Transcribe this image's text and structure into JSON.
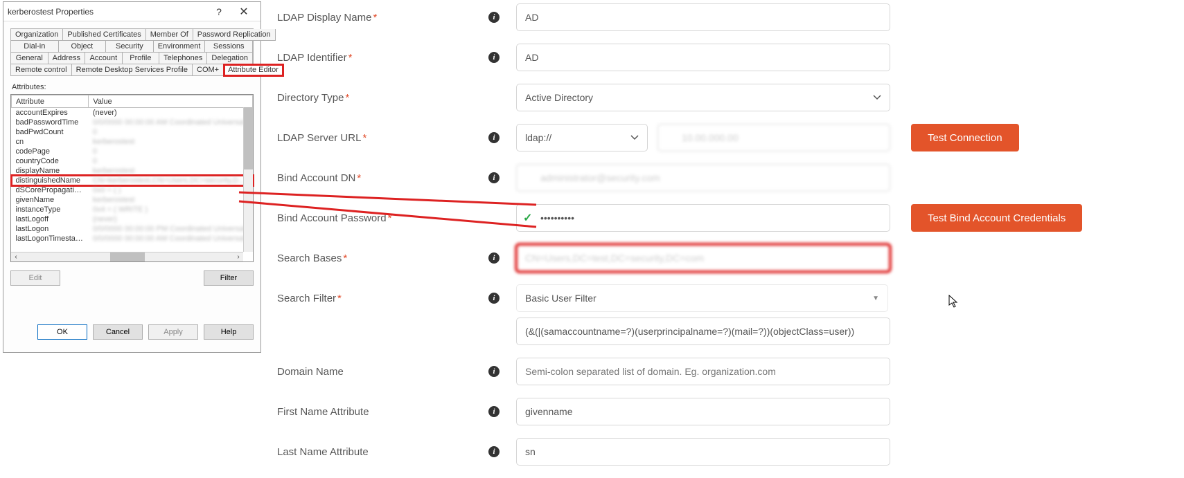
{
  "dialog": {
    "title": "kerberostest Properties",
    "help_label": "?",
    "close_label": "✕",
    "tab_rows": [
      [
        "Organization",
        "Published Certificates",
        "Member Of",
        "Password Replication"
      ],
      [
        "Dial-in",
        "Object",
        "Security",
        "Environment",
        "Sessions"
      ],
      [
        "General",
        "Address",
        "Account",
        "Profile",
        "Telephones",
        "Delegation"
      ],
      [
        "Remote control",
        "Remote Desktop Services Profile",
        "COM+",
        "Attribute Editor"
      ]
    ],
    "active_tab": "Attribute Editor",
    "attributes_label": "Attributes:",
    "columns": [
      "Attribute",
      "Value"
    ],
    "rows": [
      {
        "attr": "accountExpires",
        "val": "(never)",
        "blurred": false
      },
      {
        "attr": "badPasswordTime",
        "val": "0/0/0000 00:00:00 AM Coordinated Universal",
        "blurred": true
      },
      {
        "attr": "badPwdCount",
        "val": "0",
        "blurred": true
      },
      {
        "attr": "cn",
        "val": "kerberostest",
        "blurred": true
      },
      {
        "attr": "codePage",
        "val": "0",
        "blurred": true
      },
      {
        "attr": "countryCode",
        "val": "0",
        "blurred": true
      },
      {
        "attr": "displayName",
        "val": "kerberostest",
        "blurred": true
      },
      {
        "attr": "distinguishedName",
        "val": "CN=kerberostest,CN=Users,DC=security,DC=com",
        "blurred": true,
        "highlighted": true
      },
      {
        "attr": "dSCorePropagationD...",
        "val": "0x0 = ( )",
        "blurred": true
      },
      {
        "attr": "givenName",
        "val": "kerberostest",
        "blurred": true
      },
      {
        "attr": "instanceType",
        "val": "0x4 = ( WRITE )",
        "blurred": true
      },
      {
        "attr": "lastLogoff",
        "val": "(never)",
        "blurred": true
      },
      {
        "attr": "lastLogon",
        "val": "0/0/0000 00:00:00 PM Coordinated Universal",
        "blurred": true
      },
      {
        "attr": "lastLogonTimestamp",
        "val": "0/0/0000 00:00:00 AM Coordinated Universal",
        "blurred": true
      }
    ],
    "edit_btn": "Edit",
    "filter_btn": "Filter",
    "ok_btn": "OK",
    "cancel_btn": "Cancel",
    "apply_btn": "Apply",
    "help_btn": "Help"
  },
  "form": {
    "ldap_display_name": {
      "label": "LDAP Display Name",
      "value": "AD"
    },
    "ldap_identifier": {
      "label": "LDAP Identifier",
      "value": "AD"
    },
    "directory_type": {
      "label": "Directory Type",
      "value": "Active Directory"
    },
    "ldap_server_url": {
      "label": "LDAP Server URL",
      "scheme": "ldap://",
      "host_blurred": "10.00.000.00",
      "test_btn": "Test Connection"
    },
    "bind_dn": {
      "label": "Bind Account DN",
      "value_blurred": "administrator@security.com"
    },
    "bind_pwd": {
      "label": "Bind Account Password",
      "value": "••••••••••",
      "test_btn": "Test Bind Account Credentials"
    },
    "search_bases": {
      "label": "Search Bases",
      "value_blurred": "CN=Users,DC=test,DC=security,DC=com"
    },
    "search_filter": {
      "label": "Search Filter",
      "value": "Basic User Filter",
      "expr": "(&(|(samaccountname=?)(userprincipalname=?)(mail=?))(objectClass=user))"
    },
    "domain_name": {
      "label": "Domain Name",
      "placeholder": "Semi-colon separated list of domain. Eg. organization.com"
    },
    "first_name_attr": {
      "label": "First Name Attribute",
      "value": "givenname"
    },
    "last_name_attr": {
      "label": "Last Name Attribute",
      "value": "sn"
    }
  }
}
